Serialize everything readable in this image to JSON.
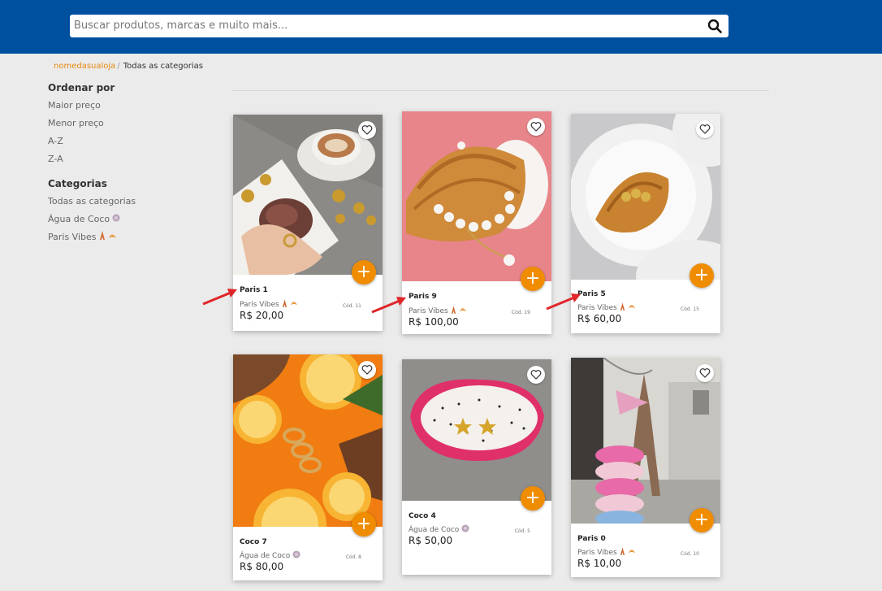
{
  "search": {
    "placeholder": "Buscar produtos, marcas e muito mais..."
  },
  "breadcrumb": {
    "store": "nomedasualoja",
    "separator": "/",
    "current": "Todas as categorias"
  },
  "sidebar": {
    "sort_title": "Ordenar por",
    "sort_items": [
      "Maior preço",
      "Menor preço",
      "A-Z",
      "Z-A"
    ],
    "categories_title": "Categorias",
    "categories": [
      "Todas as categorias",
      "Água de Coco",
      "Paris Vibes"
    ]
  },
  "products": [
    {
      "name": "Paris 1",
      "category": "Paris Vibes",
      "price": "R$ 20,00",
      "code": "Cód. 11",
      "image": "cookie-coffee-jewelry"
    },
    {
      "name": "Paris 9",
      "category": "Paris Vibes",
      "price": "R$ 100,00",
      "code": "Cód. 19",
      "image": "croissant-pearls"
    },
    {
      "name": "Paris 5",
      "category": "Paris Vibes",
      "price": "R$ 60,00",
      "code": "Cód. 15",
      "image": "croissant-plate"
    },
    {
      "name": "Coco 7",
      "category": "Água de Coco",
      "price": "R$ 80,00",
      "code": "Cód. 8",
      "image": "citrus-rings"
    },
    {
      "name": "Coco 4",
      "category": "Água de Coco",
      "price": "R$ 50,00",
      "code": "Cód. 5",
      "image": "dragonfruit-stars"
    },
    {
      "name": "Paris 0",
      "category": "Paris Vibes",
      "price": "R$ 10,00",
      "code": "Cód. 10",
      "image": "macaron-eiffel"
    }
  ],
  "add_label": "+",
  "colors": {
    "header": "#0050a0",
    "accent": "#f08c00",
    "link": "#e8860b",
    "arrow": "#e0262a"
  },
  "icons": {
    "search": "search-icon",
    "favorite": "heart-icon",
    "add": "plus-icon",
    "paris": "eiffel-croissant-emoji",
    "coco": "coconut-emoji"
  }
}
